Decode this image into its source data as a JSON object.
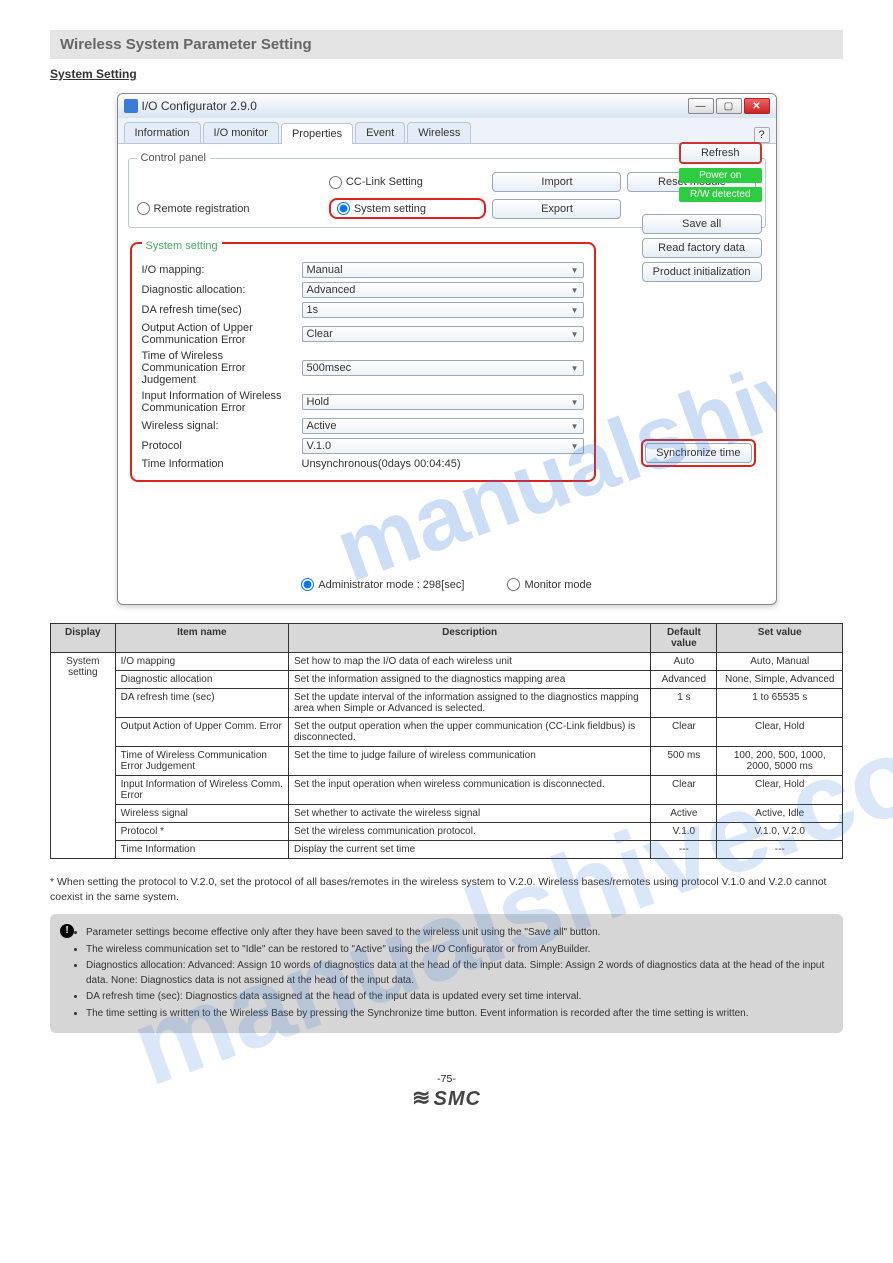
{
  "section_header": "Wireless System Parameter Setting",
  "sub_title": "System Setting",
  "window": {
    "title": "I/O Configurator 2.9.0",
    "tabs": [
      "Information",
      "I/O monitor",
      "Properties",
      "Event",
      "Wireless"
    ],
    "active_tab": "Properties",
    "control_panel_legend": "Control panel",
    "radios": {
      "remote": "Remote registration",
      "cclink": "CC-Link Setting",
      "system": "System setting"
    },
    "buttons": {
      "import": "Import",
      "export": "Export",
      "reset": "Reset module",
      "refresh": "Refresh",
      "save_all": "Save all",
      "read_factory": "Read factory data",
      "product_init": "Product initialization",
      "sync": "Synchronize time"
    },
    "status": {
      "power": "Power on",
      "rw": "R/W detected"
    },
    "sys_legend": "System setting",
    "fields": {
      "io_mapping": {
        "label": "I/O mapping:",
        "value": "Manual"
      },
      "diag_alloc": {
        "label": "Diagnostic allocation:",
        "value": "Advanced"
      },
      "da_refresh": {
        "label": "DA refresh time(sec)",
        "value": "1s"
      },
      "output_action": {
        "label": "Output Action of Upper Communication Error",
        "value": "Clear"
      },
      "time_wireless": {
        "label": "Time of Wireless Communication Error Judgement",
        "value": "500msec"
      },
      "input_info": {
        "label": "Input Information of Wireless Communication Error",
        "value": "Hold"
      },
      "wireless_signal": {
        "label": "Wireless signal:",
        "value": "Active"
      },
      "protocol": {
        "label": "Protocol",
        "value": "V.1.0"
      },
      "time_info": {
        "label": "Time Information",
        "value": "Unsynchronous(0days 00:04:45)"
      }
    },
    "mode": {
      "admin": "Administrator mode : 298[sec]",
      "monitor": "Monitor mode"
    }
  },
  "doc_table": {
    "headers": [
      "Display",
      "Item name",
      "Description",
      "Default value",
      "Set value"
    ],
    "rows": [
      {
        "display_rowspan": 9,
        "display": "System setting",
        "item": "I/O mapping",
        "desc": "Set how to map the I/O data of each wireless unit",
        "default": "Auto",
        "values": "Auto, Manual"
      },
      {
        "item": "Diagnostic allocation",
        "desc": "Set the information assigned to the diagnostics mapping area",
        "default": "Advanced",
        "values": "None, Simple, Advanced"
      },
      {
        "item": "DA refresh time (sec)",
        "desc": "Set the update interval of the information assigned to the diagnostics mapping area when Simple or Advanced is selected.",
        "default": "1 s",
        "values": "1 to 65535 s"
      },
      {
        "item": "Output Action of Upper Comm. Error",
        "desc": "Set the output operation when the upper communication (CC-Link fieldbus) is disconnected.",
        "default": "Clear",
        "values": "Clear, Hold"
      },
      {
        "item": "Time of Wireless Communication Error Judgement",
        "desc": "Set the time to judge failure of wireless communication",
        "default": "500 ms",
        "values": "100, 200, 500, 1000, 2000, 5000 ms"
      },
      {
        "item": "Input Information of Wireless Comm. Error",
        "desc": "Set the input operation when wireless communication is disconnected.",
        "default": "Clear",
        "values": "Clear, Hold"
      },
      {
        "item": "Wireless signal",
        "desc": "Set whether to activate the wireless signal",
        "default": "Active",
        "values": "Active, Idle"
      },
      {
        "item": "Protocol *",
        "desc": "Set the wireless communication protocol.",
        "default": "V.1.0",
        "values": "V.1.0, V.2.0"
      },
      {
        "item": "Time Information",
        "desc": "Display the current set time",
        "default": "---",
        "values": "---"
      }
    ]
  },
  "proto_note": "* When setting the protocol to V.2.0, set the protocol of all bases/remotes in the wireless system to V.2.0. Wireless bases/remotes using protocol V.1.0 and V.2.0 cannot coexist in the same system.",
  "alert": {
    "points": [
      "Parameter settings become effective only after they have been saved to the wireless unit using the \"Save all\" button.",
      "The wireless communication set to \"Idle\" can be restored to \"Active\" using the I/O Configurator or from AnyBuilder.",
      "Diagnostics allocation: Advanced: Assign 10 words of diagnostics data at the head of the input data. Simple: Assign 2 words of diagnostics data at the head of the input data. None: Diagnostics data is not assigned at the head of the input data.",
      "DA refresh time (sec): Diagnostics data assigned at the head of the input data is updated every set time interval.",
      "The time setting is written to the Wireless Base by pressing the Synchronize time button. Event information is recorded after the time setting is written."
    ]
  },
  "footer": {
    "page": "-75-",
    "company": "SMC"
  },
  "watermark": "manualshive.com"
}
